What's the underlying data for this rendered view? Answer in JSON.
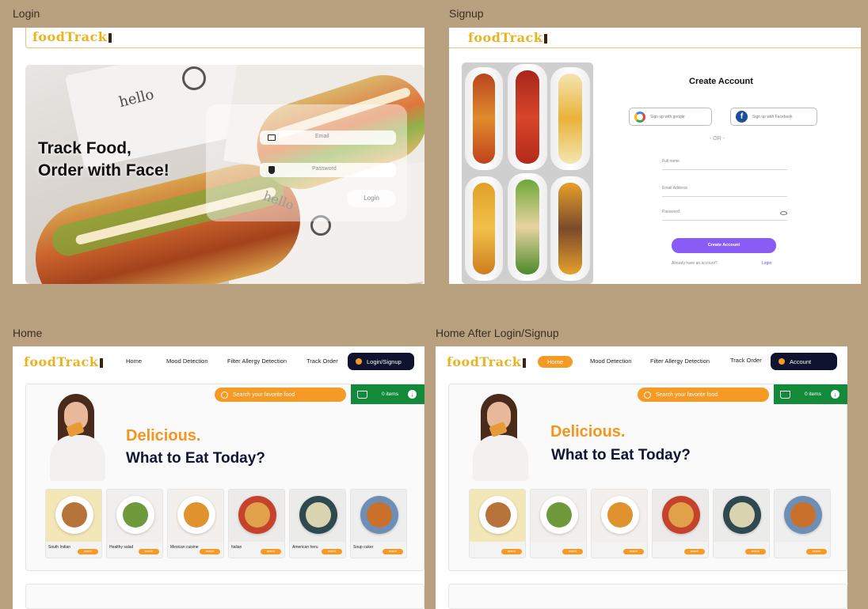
{
  "labels": {
    "login": "Login",
    "signup": "Signup",
    "home": "Home",
    "home_after": "Home After Login/Signup"
  },
  "brand": {
    "logo": "foodTrack"
  },
  "login_frame": {
    "headline_line1": "Track Food,",
    "headline_line2": "Order with Face!",
    "email_placeholder": "Email",
    "password_placeholder": "Password",
    "login_button": "Login",
    "box_text_1": "hello",
    "box_text_2": "hello"
  },
  "signup_frame": {
    "title": "Create Account",
    "google": "Sign up with google",
    "facebook": "Sign up with Facebook",
    "or": "- OR -",
    "full_name": "Full name",
    "email": "Email Address",
    "password": "Password",
    "create_button": "Create Account",
    "have_account": "Already have an account?",
    "login_link": "Login"
  },
  "home_frame": {
    "nav": [
      "Home",
      "Mood Detection",
      "Filter Allergy Detection",
      "Track Order"
    ],
    "login_signup": "Login/Signup",
    "search_placeholder": "Search your favorite food",
    "cart_items": "0 items",
    "hero_line1": "Delicious.",
    "hero_line2": "What to Eat Today?",
    "cards": [
      {
        "name": "South Indian",
        "btn": "search"
      },
      {
        "name": "Healthy salad",
        "btn": "search"
      },
      {
        "name": "Mexican cuisine",
        "btn": "search"
      },
      {
        "name": "Italian",
        "btn": "search"
      },
      {
        "name": "American heru",
        "btn": "search"
      },
      {
        "name": "Soup cuker",
        "btn": "search"
      }
    ]
  },
  "home_after_frame": {
    "nav": [
      "Home",
      "Mood Detection",
      "Filter Allergy Detection",
      "Track Order"
    ],
    "account": "Account",
    "search_placeholder": "Search your favorite food",
    "cart_items": "0 items",
    "hero_line1": "Delicious.",
    "hero_line2": "What to Eat Today?",
    "cards": [
      {
        "btn": "search"
      },
      {
        "btn": "search"
      },
      {
        "btn": "search"
      },
      {
        "btn": "search"
      },
      {
        "btn": "search"
      },
      {
        "btn": "search"
      }
    ]
  }
}
